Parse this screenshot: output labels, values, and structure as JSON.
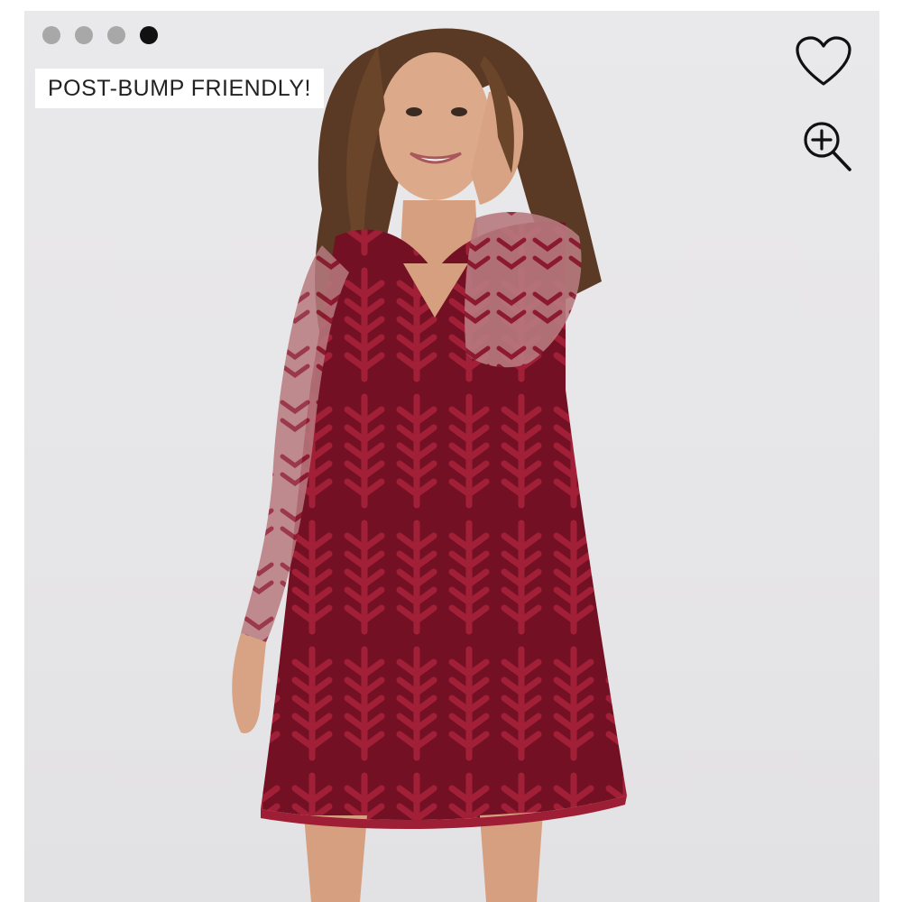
{
  "product": {
    "badge_text": "POST-BUMP FRIENDLY!",
    "image_alt": "Model wearing a burgundy lace long sleeve shift dress"
  },
  "carousel": {
    "dots": [
      {
        "active": false
      },
      {
        "active": false
      },
      {
        "active": false
      },
      {
        "active": true
      }
    ]
  },
  "actions": {
    "favorite_icon": "heart-icon",
    "zoom_icon": "zoom-in-icon"
  },
  "colors": {
    "dress": "#7a1326",
    "dress_pattern": "#9e1f35",
    "background": "#e8e7e9",
    "dot_inactive": "#a8a8a8",
    "dot_active": "#111111"
  }
}
